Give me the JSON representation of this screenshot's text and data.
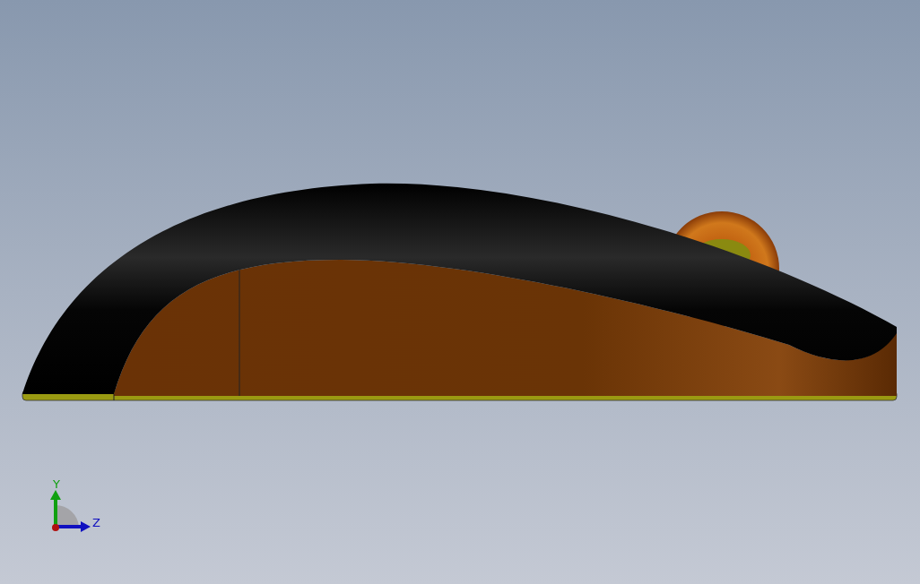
{
  "viewport": {
    "triad": {
      "axes": [
        {
          "kind": "vertical",
          "label": "Y",
          "color": "#10a010"
        },
        {
          "kind": "horizontal",
          "label": "Z",
          "color": "#1010c0"
        }
      ]
    }
  }
}
